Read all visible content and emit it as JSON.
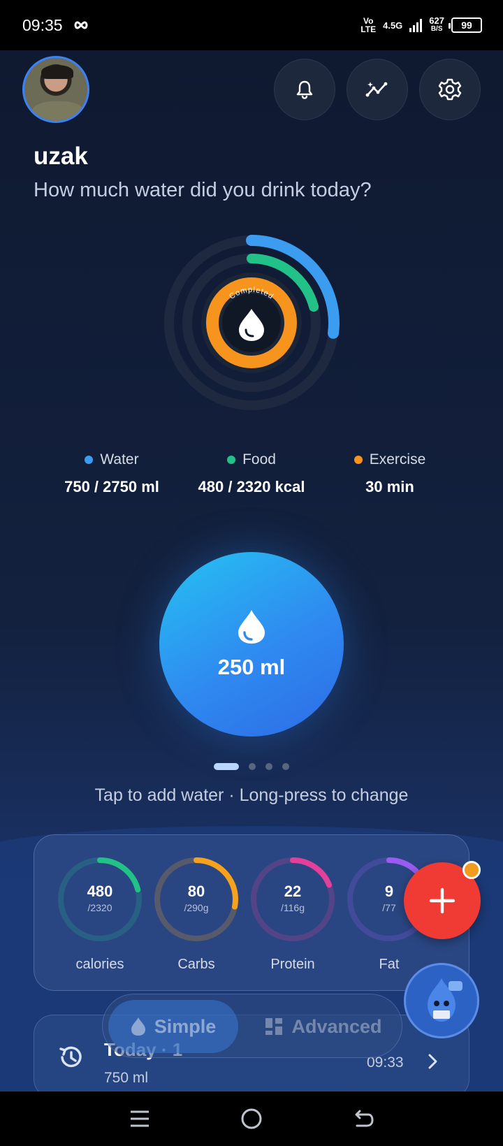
{
  "status_bar": {
    "time": "09:35",
    "volte": [
      "Vo",
      "LTE"
    ],
    "network": "4.5G",
    "speed_value": "627",
    "speed_unit": "B/S",
    "battery": "99"
  },
  "header": {
    "username": "uzak",
    "question": "How much water did you drink today?"
  },
  "rings": {
    "center_label": "Completed",
    "water_progress": 0.27,
    "food_progress": 0.21,
    "exercise_progress": 1.0
  },
  "legend": [
    {
      "label": "Water",
      "value": "750 / 2750 ml",
      "color": "#3b9cf0"
    },
    {
      "label": "Food",
      "value": "480 / 2320 kcal",
      "color": "#22c187"
    },
    {
      "label": "Exercise",
      "value": "30 min",
      "color": "#f6941d"
    }
  ],
  "quick_add": {
    "amount": "250 ml"
  },
  "hint": "Tap to add water · Long-press to change",
  "macros": [
    {
      "value": "480",
      "target": "/2320",
      "name": "calories",
      "color": "#22c187",
      "progress": 0.21
    },
    {
      "value": "80",
      "target": "/290g",
      "name": "Carbs",
      "color": "#f6a21d",
      "progress": 0.28
    },
    {
      "value": "22",
      "target": "/116g",
      "name": "Protein",
      "color": "#e2409a",
      "progress": 0.19
    },
    {
      "value": "9",
      "target": "/77",
      "name": "Fat",
      "color": "#9a5cf0",
      "progress": 0.12
    }
  ],
  "mode_toggle": {
    "simple": "Simple",
    "advanced": "Advanced"
  },
  "history": {
    "title": "Today · 1",
    "amount": "750 ml",
    "time": "09:33"
  }
}
